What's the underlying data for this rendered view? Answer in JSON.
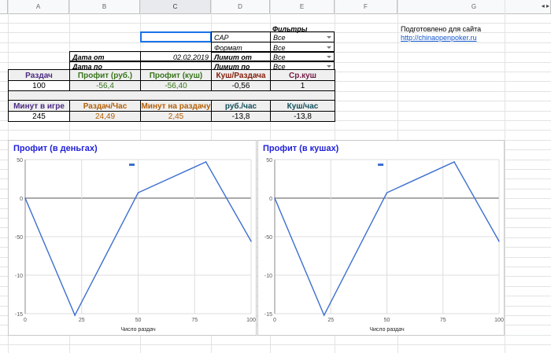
{
  "columns": [
    "A",
    "B",
    "C",
    "D",
    "E",
    "F",
    "G"
  ],
  "filters": {
    "header": "Фильтры",
    "rows": [
      {
        "label": "CAP",
        "value": "Все"
      },
      {
        "label": "Формат",
        "value": "Все"
      },
      {
        "label": "Лимит от",
        "value": "Все"
      },
      {
        "label": "Лимит по",
        "value": "Все"
      }
    ]
  },
  "dates": {
    "from_label": "Дата от",
    "from_value": "02.02.2019",
    "to_label": "Дата по",
    "to_value": ""
  },
  "credit": {
    "text": "Подготовлено для сайта",
    "link": "http://chinaopenpoker.ru"
  },
  "stats1": {
    "headers": [
      "Раздач",
      "Профит (руб.)",
      "Профит (куш)",
      "Куш/Раздача",
      "Ср.куш"
    ],
    "values": [
      "100",
      "-56,4",
      "-56,40",
      "-0,56",
      "1"
    ],
    "colors": [
      "#4b2a82",
      "#38761d",
      "#38761d",
      "#85200c",
      "#741b47"
    ]
  },
  "stats2": {
    "headers": [
      "Минут в игре",
      "Раздач/Час",
      "Минут на раздачу",
      "руб./час",
      "Куш/час"
    ],
    "values": [
      "245",
      "24,49",
      "2,45",
      "-13,8",
      "-13,8"
    ],
    "colors": [
      "#4b2a82",
      "#b45f06",
      "#b45f06",
      "#134f5c",
      "#134f5c"
    ]
  },
  "colors": {
    "line": "#3d6fd0",
    "title": "#1f1fd8",
    "selected": "#1a73e8"
  },
  "chart_data": [
    {
      "type": "line",
      "title": "Профит (в деньгах)",
      "xlabel": "Число раздач",
      "ylabel": "",
      "xlim": [
        0,
        100
      ],
      "ylim": [
        -150,
        50
      ],
      "x_ticks": [
        "0",
        "25",
        "50",
        "75",
        "100"
      ],
      "y_ticks": [
        "50",
        "0",
        "-50",
        "-10",
        "-15"
      ],
      "series": [
        {
          "x": [
            0,
            22,
            50,
            80,
            100
          ],
          "y": [
            0,
            -152,
            7,
            47,
            -56
          ]
        }
      ]
    },
    {
      "type": "line",
      "title": "Профит (в кушах)",
      "xlabel": "Число раздач",
      "ylabel": "",
      "xlim": [
        0,
        100
      ],
      "ylim": [
        -150,
        50
      ],
      "x_ticks": [
        "0",
        "25",
        "50",
        "75",
        "100"
      ],
      "y_ticks": [
        "50",
        "0",
        "-50",
        "-10",
        "-15"
      ],
      "series": [
        {
          "x": [
            0,
            22,
            50,
            80,
            100
          ],
          "y": [
            0,
            -152,
            7,
            47,
            -56
          ]
        }
      ]
    }
  ]
}
